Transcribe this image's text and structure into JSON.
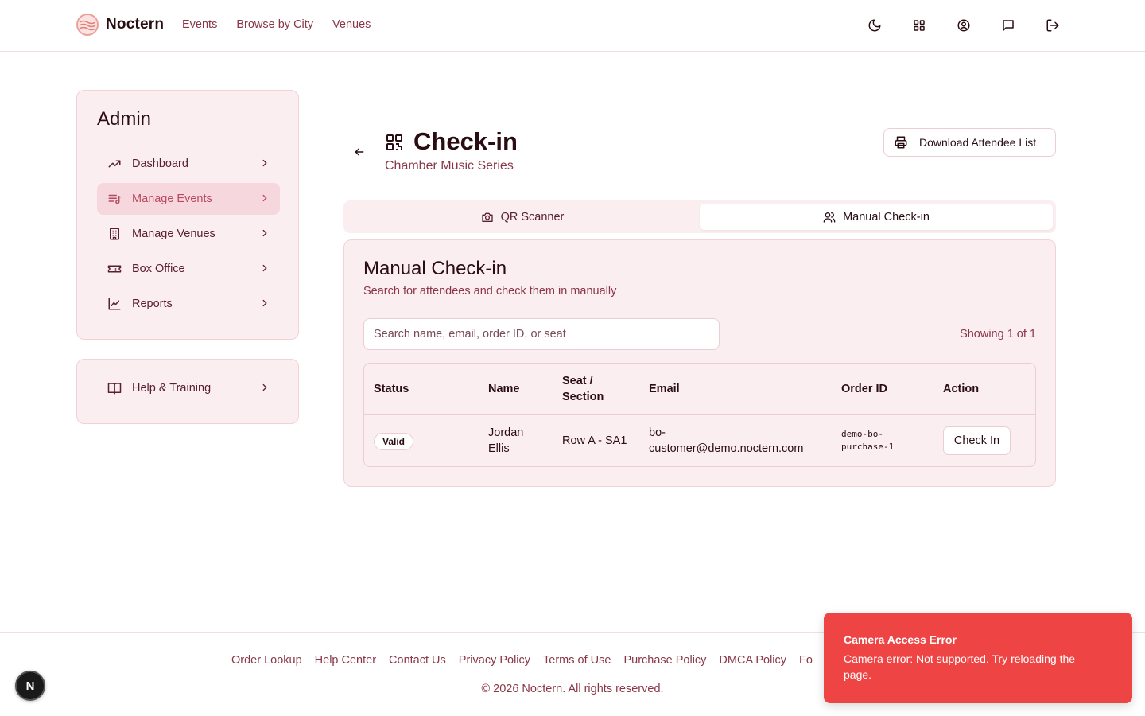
{
  "brand": {
    "name": "Noctern"
  },
  "nav": {
    "items": [
      "Events",
      "Browse by City",
      "Venues"
    ]
  },
  "header_icons": [
    "moon-icon",
    "grid-icon",
    "user-circle-icon",
    "message-icon",
    "logout-icon"
  ],
  "sidebar": {
    "title": "Admin",
    "items": [
      {
        "label": "Dashboard",
        "icon": "trending-up-icon",
        "active": false
      },
      {
        "label": "Manage Events",
        "icon": "list-music-icon",
        "active": true
      },
      {
        "label": "Manage Venues",
        "icon": "building-icon",
        "active": false
      },
      {
        "label": "Box Office",
        "icon": "ticket-icon",
        "active": false
      },
      {
        "label": "Reports",
        "icon": "line-chart-icon",
        "active": false
      }
    ],
    "help": {
      "label": "Help & Training",
      "icon": "book-icon"
    }
  },
  "page": {
    "title": "Check-in",
    "subtitle": "Chamber Music Series",
    "download_label": "Download Attendee List"
  },
  "tabs": [
    {
      "label": "QR Scanner",
      "icon": "camera-icon",
      "active": false
    },
    {
      "label": "Manual Check-in",
      "icon": "users-icon",
      "active": true
    }
  ],
  "manual": {
    "title": "Manual Check-in",
    "description": "Search for attendees and check them in manually",
    "search_placeholder": "Search name, email, order ID, or seat",
    "showing": "Showing 1 of 1",
    "columns": {
      "status": "Status",
      "name_col": "Name",
      "seat_line1": "Seat /",
      "seat_line2": "Section",
      "email": "Email",
      "order": "Order ID",
      "action": "Action"
    },
    "rows": [
      {
        "status": "Valid",
        "name_line1": "Jordan",
        "name_line2": "Ellis",
        "seat": "Row A - SA1",
        "email_line1": "bo-",
        "email_line2": "customer@demo.noctern.com",
        "order_line1": "demo-bo-",
        "order_line2": "purchase-1",
        "action": "Check In"
      }
    ]
  },
  "footer": {
    "links": [
      "Order Lookup",
      "Help Center",
      "Contact Us",
      "Privacy Policy",
      "Terms of Use",
      "Purchase Policy",
      "DMCA Policy",
      "Fo"
    ],
    "copyright": "© 2026 Noctern. All rights reserved."
  },
  "dev_badge": "N",
  "toast": {
    "title": "Camera Access Error",
    "message_line1": "Camera error: Not supported. Try reloading the",
    "message_line2": "page."
  },
  "colors": {
    "accent": "#b84a60",
    "panel_bg": "#fbeef0",
    "toast_bg": "#ef4444",
    "text": "#2a0d12",
    "muted": "#8a3648"
  }
}
